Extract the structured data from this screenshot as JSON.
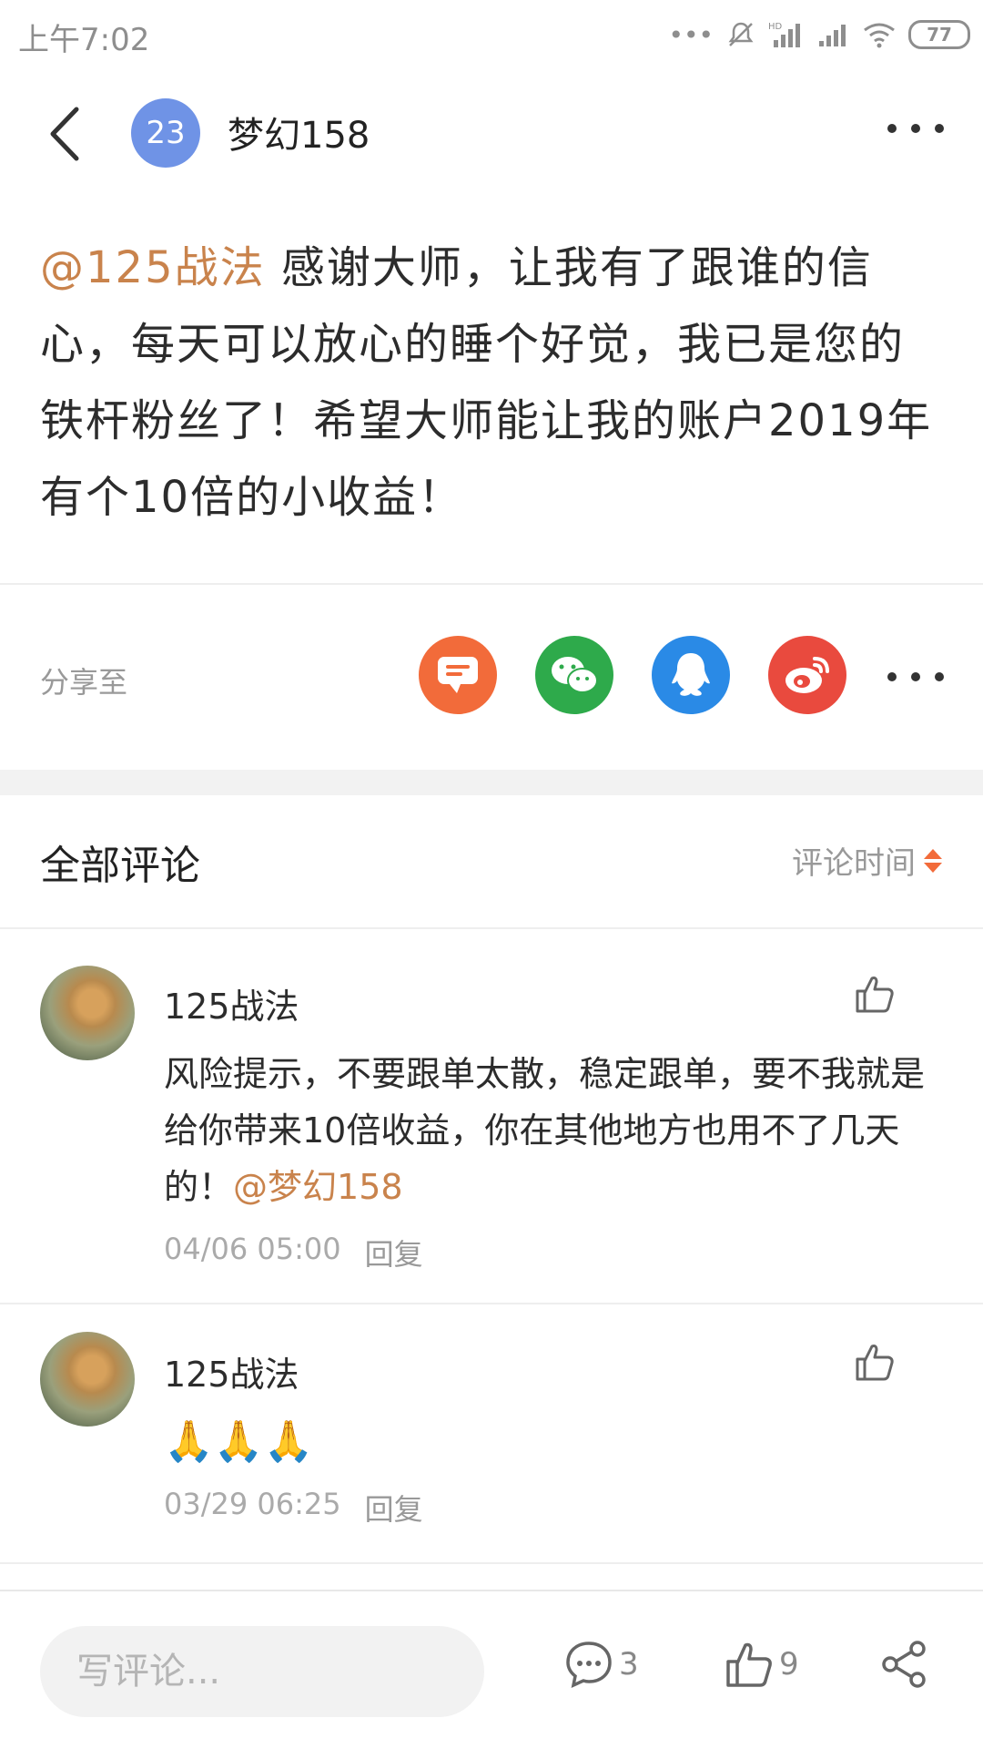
{
  "status_bar": {
    "time": "上午7:02",
    "battery": "77"
  },
  "header": {
    "badge": "23",
    "author": "梦幻158"
  },
  "post": {
    "mention": "@125战法",
    "text": " 感谢大师，让我有了跟谁的信心，每天可以放心的睡个好觉，我已是您的铁杆粉丝了！希望大师能让我的账户2019年有个10倍的小收益！"
  },
  "share": {
    "label": "分享至",
    "targets": [
      "message-icon",
      "wechat-icon",
      "qq-icon",
      "weibo-icon"
    ],
    "colors": {
      "message": "#f26b3a",
      "wechat": "#2eaa4b",
      "qq": "#2a8ae6",
      "weibo": "#e94a3e"
    }
  },
  "comments_header": {
    "title": "全部评论",
    "sort_label": "评论时间"
  },
  "comments": [
    {
      "user": "125战法",
      "text": "风险提示，不要跟单太散，稳定跟单，要不我就是给你带来10倍收益，你在其他地方也用不了几天的！",
      "mention": "@梦幻158",
      "time": "04/06 05:00",
      "reply": "回复"
    },
    {
      "user": "125战法",
      "text": "🙏🙏🙏",
      "time": "03/29 06:25",
      "reply": "回复"
    }
  ],
  "bottom_bar": {
    "placeholder": "写评论...",
    "comment_count": "3",
    "like_count": "9"
  },
  "colors": {
    "accent": "#c9834c",
    "muted": "#999999"
  }
}
